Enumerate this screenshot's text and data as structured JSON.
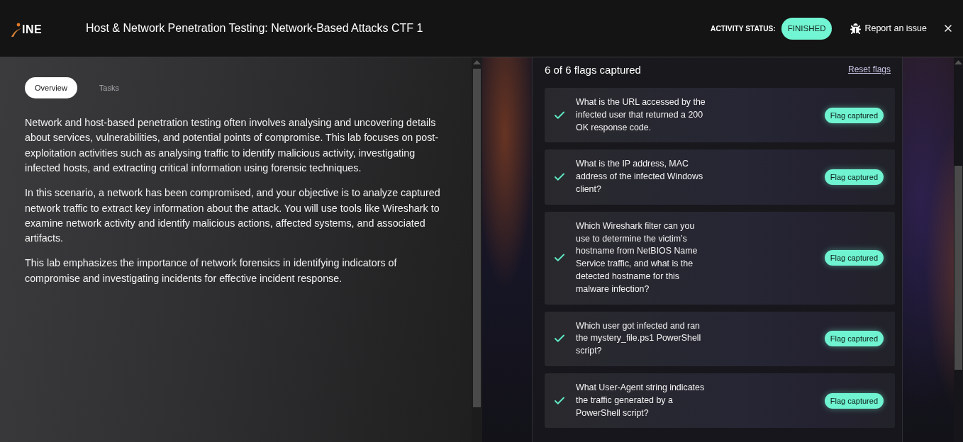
{
  "header": {
    "logo": "INE",
    "title": "Host & Network Penetration Testing: Network-Based Attacks CTF 1",
    "status_label": "ACTIVITY STATUS:",
    "status": "FINISHED",
    "report_link": "Report an issue"
  },
  "overview": {
    "tabs": [
      {
        "label": "Overview",
        "selected": true
      },
      {
        "label": "Tasks",
        "selected": false
      }
    ],
    "paragraphs": [
      "Network and host-based penetration testing often involves analysing and uncovering details about services, vulnerabilities, and potential points of compromise. This lab focuses on post-exploitation activities such as analysing traffic to identify malicious activity, investigating infected hosts, and extracting critical information using forensic techniques.",
      "In this scenario, a network has been compromised, and your objective is to analyze captured network traffic to extract key information about the attack. You will use tools like Wireshark to examine network activity and identify malicious actions, affected systems, and associated artifacts.",
      "This lab emphasizes the importance of network forensics in identifying indicators of compromise and investigating incidents for effective incident response."
    ]
  },
  "flags": {
    "summary": "6 of 6 flags captured",
    "reset_link": "Reset flags",
    "items": [
      {
        "question": "What is the URL accessed by the infected user that returned a 200 OK response code.",
        "captured": true,
        "badge": "Flag captured"
      },
      {
        "question": "What is the IP address, MAC address of the infected Windows client?",
        "captured": true,
        "badge": "Flag captured"
      },
      {
        "question": "Which Wireshark filter can you use to determine the victim’s hostname from NetBIOS Name Service traffic, and what is the detected hostname for this malware infection?",
        "captured": true,
        "badge": "Flag captured"
      },
      {
        "question": "Which user got infected and ran the mystery_file.ps1 PowerShell script?",
        "captured": true,
        "badge": "Flag captured"
      },
      {
        "question": "What User-Agent string indicates the traffic generated by a PowerShell script?",
        "captured": true,
        "badge": "Flag captured"
      }
    ]
  }
}
